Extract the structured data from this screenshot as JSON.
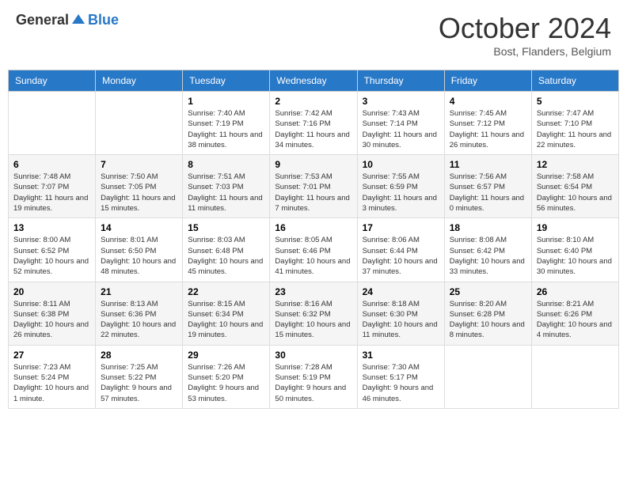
{
  "header": {
    "logo_general": "General",
    "logo_blue": "Blue",
    "month_year": "October 2024",
    "location": "Bost, Flanders, Belgium"
  },
  "days_of_week": [
    "Sunday",
    "Monday",
    "Tuesday",
    "Wednesday",
    "Thursday",
    "Friday",
    "Saturday"
  ],
  "weeks": [
    [
      {
        "day": "",
        "sunrise": "",
        "sunset": "",
        "daylight": ""
      },
      {
        "day": "",
        "sunrise": "",
        "sunset": "",
        "daylight": ""
      },
      {
        "day": "1",
        "sunrise": "Sunrise: 7:40 AM",
        "sunset": "Sunset: 7:19 PM",
        "daylight": "Daylight: 11 hours and 38 minutes."
      },
      {
        "day": "2",
        "sunrise": "Sunrise: 7:42 AM",
        "sunset": "Sunset: 7:16 PM",
        "daylight": "Daylight: 11 hours and 34 minutes."
      },
      {
        "day": "3",
        "sunrise": "Sunrise: 7:43 AM",
        "sunset": "Sunset: 7:14 PM",
        "daylight": "Daylight: 11 hours and 30 minutes."
      },
      {
        "day": "4",
        "sunrise": "Sunrise: 7:45 AM",
        "sunset": "Sunset: 7:12 PM",
        "daylight": "Daylight: 11 hours and 26 minutes."
      },
      {
        "day": "5",
        "sunrise": "Sunrise: 7:47 AM",
        "sunset": "Sunset: 7:10 PM",
        "daylight": "Daylight: 11 hours and 22 minutes."
      }
    ],
    [
      {
        "day": "6",
        "sunrise": "Sunrise: 7:48 AM",
        "sunset": "Sunset: 7:07 PM",
        "daylight": "Daylight: 11 hours and 19 minutes."
      },
      {
        "day": "7",
        "sunrise": "Sunrise: 7:50 AM",
        "sunset": "Sunset: 7:05 PM",
        "daylight": "Daylight: 11 hours and 15 minutes."
      },
      {
        "day": "8",
        "sunrise": "Sunrise: 7:51 AM",
        "sunset": "Sunset: 7:03 PM",
        "daylight": "Daylight: 11 hours and 11 minutes."
      },
      {
        "day": "9",
        "sunrise": "Sunrise: 7:53 AM",
        "sunset": "Sunset: 7:01 PM",
        "daylight": "Daylight: 11 hours and 7 minutes."
      },
      {
        "day": "10",
        "sunrise": "Sunrise: 7:55 AM",
        "sunset": "Sunset: 6:59 PM",
        "daylight": "Daylight: 11 hours and 3 minutes."
      },
      {
        "day": "11",
        "sunrise": "Sunrise: 7:56 AM",
        "sunset": "Sunset: 6:57 PM",
        "daylight": "Daylight: 11 hours and 0 minutes."
      },
      {
        "day": "12",
        "sunrise": "Sunrise: 7:58 AM",
        "sunset": "Sunset: 6:54 PM",
        "daylight": "Daylight: 10 hours and 56 minutes."
      }
    ],
    [
      {
        "day": "13",
        "sunrise": "Sunrise: 8:00 AM",
        "sunset": "Sunset: 6:52 PM",
        "daylight": "Daylight: 10 hours and 52 minutes."
      },
      {
        "day": "14",
        "sunrise": "Sunrise: 8:01 AM",
        "sunset": "Sunset: 6:50 PM",
        "daylight": "Daylight: 10 hours and 48 minutes."
      },
      {
        "day": "15",
        "sunrise": "Sunrise: 8:03 AM",
        "sunset": "Sunset: 6:48 PM",
        "daylight": "Daylight: 10 hours and 45 minutes."
      },
      {
        "day": "16",
        "sunrise": "Sunrise: 8:05 AM",
        "sunset": "Sunset: 6:46 PM",
        "daylight": "Daylight: 10 hours and 41 minutes."
      },
      {
        "day": "17",
        "sunrise": "Sunrise: 8:06 AM",
        "sunset": "Sunset: 6:44 PM",
        "daylight": "Daylight: 10 hours and 37 minutes."
      },
      {
        "day": "18",
        "sunrise": "Sunrise: 8:08 AM",
        "sunset": "Sunset: 6:42 PM",
        "daylight": "Daylight: 10 hours and 33 minutes."
      },
      {
        "day": "19",
        "sunrise": "Sunrise: 8:10 AM",
        "sunset": "Sunset: 6:40 PM",
        "daylight": "Daylight: 10 hours and 30 minutes."
      }
    ],
    [
      {
        "day": "20",
        "sunrise": "Sunrise: 8:11 AM",
        "sunset": "Sunset: 6:38 PM",
        "daylight": "Daylight: 10 hours and 26 minutes."
      },
      {
        "day": "21",
        "sunrise": "Sunrise: 8:13 AM",
        "sunset": "Sunset: 6:36 PM",
        "daylight": "Daylight: 10 hours and 22 minutes."
      },
      {
        "day": "22",
        "sunrise": "Sunrise: 8:15 AM",
        "sunset": "Sunset: 6:34 PM",
        "daylight": "Daylight: 10 hours and 19 minutes."
      },
      {
        "day": "23",
        "sunrise": "Sunrise: 8:16 AM",
        "sunset": "Sunset: 6:32 PM",
        "daylight": "Daylight: 10 hours and 15 minutes."
      },
      {
        "day": "24",
        "sunrise": "Sunrise: 8:18 AM",
        "sunset": "Sunset: 6:30 PM",
        "daylight": "Daylight: 10 hours and 11 minutes."
      },
      {
        "day": "25",
        "sunrise": "Sunrise: 8:20 AM",
        "sunset": "Sunset: 6:28 PM",
        "daylight": "Daylight: 10 hours and 8 minutes."
      },
      {
        "day": "26",
        "sunrise": "Sunrise: 8:21 AM",
        "sunset": "Sunset: 6:26 PM",
        "daylight": "Daylight: 10 hours and 4 minutes."
      }
    ],
    [
      {
        "day": "27",
        "sunrise": "Sunrise: 7:23 AM",
        "sunset": "Sunset: 5:24 PM",
        "daylight": "Daylight: 10 hours and 1 minute."
      },
      {
        "day": "28",
        "sunrise": "Sunrise: 7:25 AM",
        "sunset": "Sunset: 5:22 PM",
        "daylight": "Daylight: 9 hours and 57 minutes."
      },
      {
        "day": "29",
        "sunrise": "Sunrise: 7:26 AM",
        "sunset": "Sunset: 5:20 PM",
        "daylight": "Daylight: 9 hours and 53 minutes."
      },
      {
        "day": "30",
        "sunrise": "Sunrise: 7:28 AM",
        "sunset": "Sunset: 5:19 PM",
        "daylight": "Daylight: 9 hours and 50 minutes."
      },
      {
        "day": "31",
        "sunrise": "Sunrise: 7:30 AM",
        "sunset": "Sunset: 5:17 PM",
        "daylight": "Daylight: 9 hours and 46 minutes."
      },
      {
        "day": "",
        "sunrise": "",
        "sunset": "",
        "daylight": ""
      },
      {
        "day": "",
        "sunrise": "",
        "sunset": "",
        "daylight": ""
      }
    ]
  ]
}
